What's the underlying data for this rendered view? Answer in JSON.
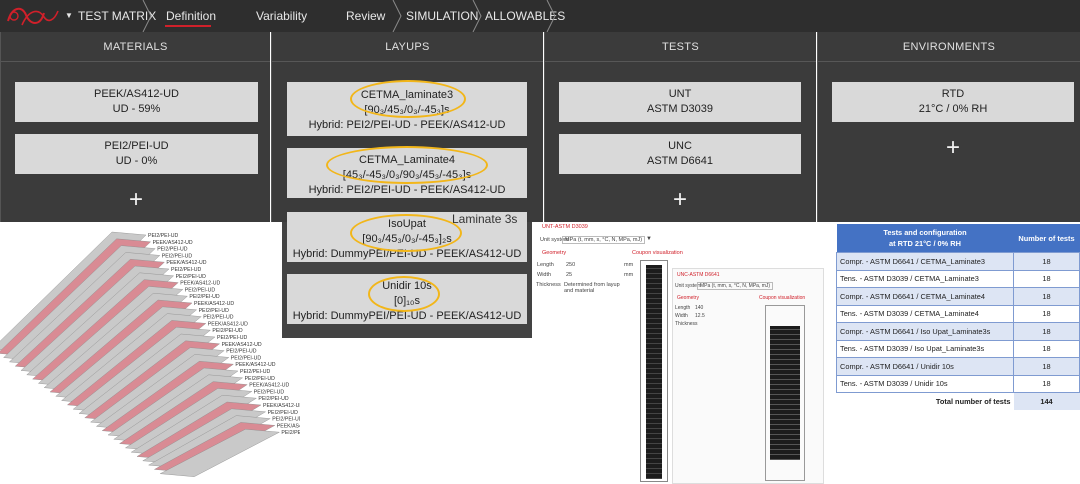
{
  "nav": {
    "items": [
      "TEST MATRIX",
      "Definition",
      "Variability",
      "Review",
      "SIMULATION",
      "ALLOWABLES"
    ],
    "active": "Definition"
  },
  "columns": {
    "materials": {
      "title": "MATERIALS",
      "cards": [
        {
          "line1": "PEEK/AS412-UD",
          "line2": "UD - 59%"
        },
        {
          "line1": "PEI2/PEI-UD",
          "line2": "UD - 0%"
        }
      ]
    },
    "layups": {
      "title": "LAYUPS",
      "cards": [
        {
          "line1": "CETMA_laminate3",
          "line2": "[90₃/45₃/0₃/-45₃]s",
          "line3": "Hybrid: PEI2/PEI-UD - PEEK/AS412-UD"
        },
        {
          "line1": "CETMA_Laminate4",
          "line2": "[45₃/-45₃/0₃/90₃/45₃/-45₃]s",
          "line3": "Hybrid: PEI2/PEI-UD - PEEK/AS412-UD"
        },
        {
          "line1": "IsoUpat",
          "line2": "[90₃/45₃/0₃/-45₃]₂s",
          "line3": "Hybrid: DummyPEI/PEI-UD - PEEK/AS412-UD"
        },
        {
          "line1": "Unidir 10s",
          "line2": "[0]₁₀s",
          "line3": "Hybrid: DummyPEI/PEI-UD - PEEK/AS412-UD"
        }
      ],
      "note": "Laminate 3s"
    },
    "tests": {
      "title": "TESTS",
      "cards": [
        {
          "line1": "UNT",
          "line2": "ASTM D3039"
        },
        {
          "line1": "UNC",
          "line2": "ASTM D6641"
        }
      ]
    },
    "environments": {
      "title": "ENVIRONMENTS",
      "cards": [
        {
          "line1": "RTD",
          "line2": "21°C / 0% RH"
        }
      ]
    },
    "add_symbol": "+"
  },
  "unit_panel": {
    "title": "UNT-ASTM D3039",
    "unit_system_label": "Unit system",
    "unit_system_value": "MPa (t, mm, s, °C, N, MPa, mJ)",
    "geometry_label": "Geometry",
    "coupon_label": "Coupon visualization",
    "length_label": "Length",
    "length_value": "250",
    "length_unit": "mm",
    "width_label": "Width",
    "width_value": "25",
    "width_unit": "mm",
    "thickness_label": "Thickness",
    "thickness_value": "Determined from layup and material",
    "inner_title": "UNC-ASTM D6641",
    "inner_length": "140",
    "inner_width": "12.5"
  },
  "results": {
    "header_line1": "Tests and configuration",
    "header_line2": "at RTD 21°C / 0% RH",
    "header_count": "Number of tests",
    "rows": [
      {
        "name": "Compr. - ASTM D6641 / CETMA_Laminate3",
        "count": "18"
      },
      {
        "name": "Tens. - ASTM D3039 / CETMA_Laminate3",
        "count": "18"
      },
      {
        "name": "Compr. - ASTM D6641 / CETMA_Laminate4",
        "count": "18"
      },
      {
        "name": "Tens. - ASTM D3039 / CETMA_Laminate4",
        "count": "18"
      },
      {
        "name": "Compr. - ASTM D6641 / Iso Upat_Laminate3s",
        "count": "18"
      },
      {
        "name": "Tens. - ASTM D3039 / Iso Upat_Laminate3s",
        "count": "18"
      },
      {
        "name": "Compr. - ASTM D6641 / Unidir 10s",
        "count": "18"
      },
      {
        "name": "Tens. - ASTM D3039 / Unidir 10s",
        "count": "18"
      }
    ],
    "total_label": "Total number of tests",
    "total_value": "144"
  },
  "stack_labels": [
    "PEI2/PEI-UD",
    "PEEK/AS412-UD"
  ],
  "colors": {
    "topbar": "#2e2e2e",
    "column": "#3b3b3b",
    "card": "#d9d9d9",
    "highlight": "#f2b619",
    "accent_red": "#d0202a",
    "table_header": "#4472c4"
  }
}
